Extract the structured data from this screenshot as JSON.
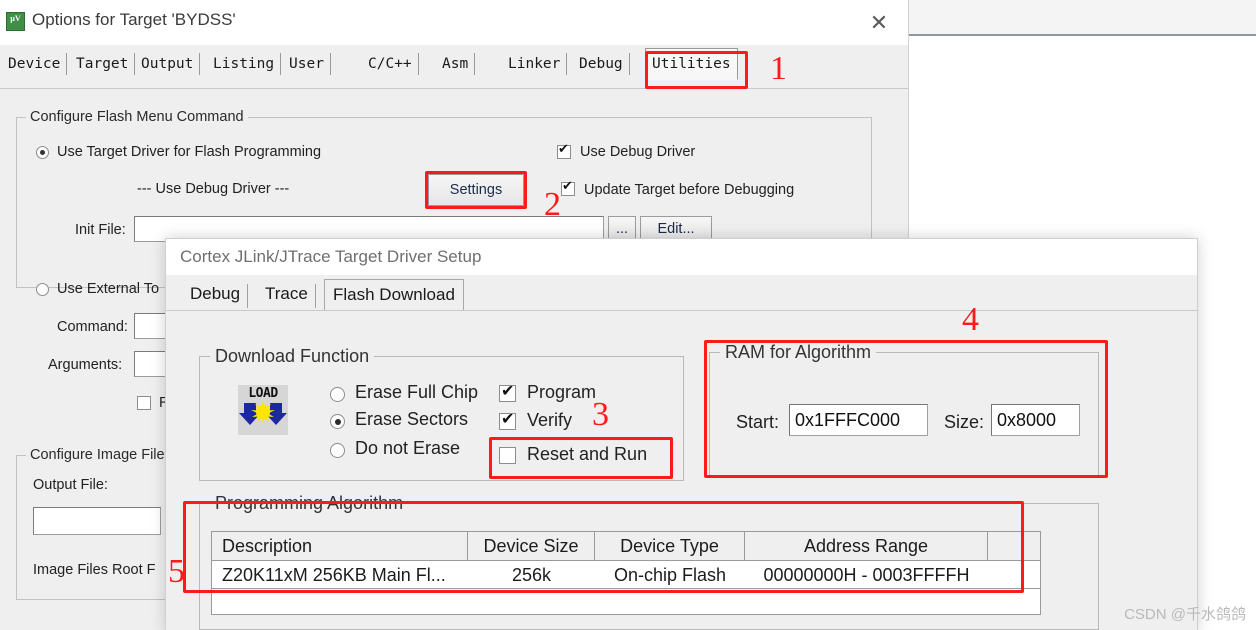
{
  "options_dialog": {
    "title": "Options for Target 'BYDSS'",
    "icon_line1": "µV",
    "icon_line2": "5",
    "close_label": "✕",
    "tabs": [
      {
        "label": "Device",
        "selected": false
      },
      {
        "label": "Target",
        "selected": false
      },
      {
        "label": "Output",
        "selected": false
      },
      {
        "label": "Listing",
        "selected": false
      },
      {
        "label": "User",
        "selected": false
      },
      {
        "label": "C/C++",
        "selected": false
      },
      {
        "label": "Asm",
        "selected": false
      },
      {
        "label": "Linker",
        "selected": false
      },
      {
        "label": "Debug",
        "selected": false
      },
      {
        "label": "Utilities",
        "selected": true
      }
    ],
    "flash_group": {
      "title": "Configure Flash Menu Command",
      "use_target_driver_label": "Use Target Driver for Flash Programming",
      "use_debug_driver_text": "--- Use Debug Driver ---",
      "settings_button": "Settings",
      "init_file_label": "Init File:",
      "init_file_value": "",
      "browse_button": "...",
      "edit_button": "Edit...",
      "use_debug_driver_checkbox": "Use Debug Driver",
      "update_target_checkbox": "Update Target before Debugging",
      "use_external_tool_label": "Use External To",
      "command_label": "Command:",
      "command_value": "",
      "arguments_label": "Arguments:",
      "arguments_value": "",
      "run_independent_label": "R"
    },
    "image_group": {
      "title": "Configure Image File",
      "output_file_label": "Output File:",
      "output_file_value": "",
      "image_root_label": "Image Files Root F"
    }
  },
  "jlink_dialog": {
    "title": "Cortex JLink/JTrace Target Driver Setup",
    "tabs": [
      {
        "label": "Debug",
        "selected": false
      },
      {
        "label": "Trace",
        "selected": false
      },
      {
        "label": "Flash Download",
        "selected": true
      }
    ],
    "download_function": {
      "title": "Download Function",
      "icon_text": "LOAD",
      "radios": [
        {
          "label": "Erase Full Chip",
          "checked": false
        },
        {
          "label": "Erase Sectors",
          "checked": true
        },
        {
          "label": "Do not Erase",
          "checked": false
        }
      ],
      "checkboxes": [
        {
          "label": "Program",
          "checked": true
        },
        {
          "label": "Verify",
          "checked": true
        },
        {
          "label": "Reset and Run",
          "checked": false
        }
      ]
    },
    "ram_for_algorithm": {
      "title": "RAM for Algorithm",
      "start_label": "Start:",
      "start_value": "0x1FFFC000",
      "size_label": "Size:",
      "size_value": "0x8000"
    },
    "programming_algorithm": {
      "title": "Programming Algorithm",
      "columns": [
        "Description",
        "Device Size",
        "Device Type",
        "Address Range",
        ""
      ],
      "rows": [
        [
          "Z20K11xM 256KB Main Fl...",
          "256k",
          "On-chip Flash",
          "00000000H - 0003FFFFH",
          ""
        ]
      ]
    }
  },
  "annotations": {
    "accent_color": "#ff1a1a",
    "markers": [
      {
        "id": "1",
        "target": "utilities-tab"
      },
      {
        "id": "2",
        "target": "settings-button"
      },
      {
        "id": "3",
        "target": "reset-and-run-checkbox"
      },
      {
        "id": "4",
        "target": "ram-for-algorithm-group"
      },
      {
        "id": "5",
        "target": "programming-algorithm-table"
      }
    ]
  },
  "watermark": {
    "text": "CSDN @千水鸽鸽"
  }
}
